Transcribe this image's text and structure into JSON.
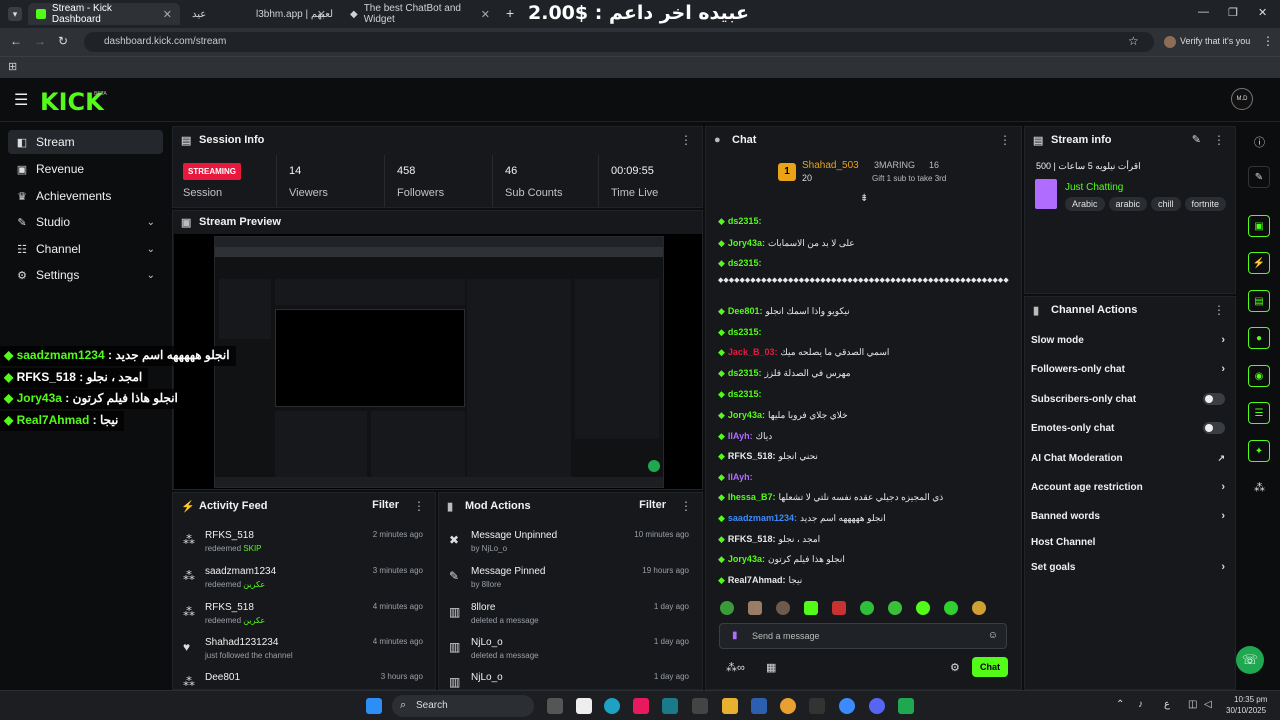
{
  "browser": {
    "tabs": [
      {
        "label": "Stream - Kick Dashboard",
        "active": true
      },
      {
        "label": "عيد",
        "active": false
      },
      {
        "label": "l3bhm.app | لعبهم",
        "active": false
      },
      {
        "label": "The best ChatBot and Widget",
        "active": false
      }
    ],
    "banner": "عبيده اخر داعم : $2.00",
    "url": "dashboard.kick.com/stream",
    "verify": "Verify that it's you"
  },
  "kick": {
    "logo": "KICK",
    "beta": "BETA",
    "avatar": "M.D"
  },
  "sidebar": {
    "items": [
      {
        "label": "Stream"
      },
      {
        "label": "Revenue"
      },
      {
        "label": "Achievements"
      },
      {
        "label": "Studio"
      },
      {
        "label": "Channel"
      },
      {
        "label": "Settings"
      }
    ]
  },
  "session": {
    "title": "Session Info",
    "badge": "STREAMING",
    "session_label": "Session",
    "viewers": "14",
    "viewers_label": "Viewers",
    "followers": "458",
    "followers_label": "Followers",
    "subs": "46",
    "subs_label": "Sub Counts",
    "time": "00:09:55",
    "time_label": "Time Live"
  },
  "preview": {
    "title": "Stream Preview"
  },
  "overlay": [
    {
      "user": "saadzmam1234",
      "text": "انجلو هههههه اسم جديد"
    },
    {
      "user": "RFKS_518",
      "text": "امجد ، نجلو"
    },
    {
      "user": "Jory43a",
      "text": "انجلو هاذا فيلم كرتون"
    },
    {
      "user": "Real7Ahmad",
      "text": "نيجا"
    }
  ],
  "activity": {
    "title": "Activity Feed",
    "filter": "Filter",
    "rows": [
      {
        "name": "RFKS_518",
        "pre": "redeemed",
        "sub": "SKIP",
        "time": "2 minutes ago"
      },
      {
        "name": "saadzmam1234",
        "pre": "redeemed",
        "sub": "عكرين",
        "time": "3 minutes ago"
      },
      {
        "name": "RFKS_518",
        "pre": "redeemed",
        "sub": "عكرين",
        "time": "4 minutes ago"
      },
      {
        "name": "Shahad1231234",
        "pre": "just followed the channel",
        "sub": "",
        "time": "4 minutes ago"
      },
      {
        "name": "Dee801",
        "pre": "",
        "sub": "",
        "time": "3 hours ago"
      }
    ]
  },
  "mod": {
    "title": "Mod Actions",
    "filter": "Filter",
    "rows": [
      {
        "name": "Message Unpinned",
        "sub": "by NjLo_o",
        "time": "10 minutes ago"
      },
      {
        "name": "Message Pinned",
        "sub": "by 8llore",
        "time": "19 hours ago"
      },
      {
        "name": "8llore",
        "sub": "deleted a message",
        "time": "1 day ago"
      },
      {
        "name": "NjLo_o",
        "sub": "deleted a message",
        "time": "1 day ago"
      },
      {
        "name": "NjLo_o",
        "sub": "",
        "time": "1 day ago"
      }
    ]
  },
  "chat": {
    "title": "Chat",
    "gifter_name": "Shahad_503",
    "gifter_count": "20",
    "gift_rank": "3MARING",
    "gift_num": "16",
    "gift_text": "Gift 1 sub to take 3rd",
    "gift_pos": "1",
    "messages": [
      {
        "user": "ds2315:",
        "text": "",
        "color": "#53fc18"
      },
      {
        "user": "Jory43a:",
        "text": "على لا بد من الاسمابات",
        "color": "#53fc18"
      },
      {
        "user": "ds2315:",
        "text": "",
        "color": "#53fc18"
      },
      {
        "user": "",
        "text": "◆◆◆◆◆◆◆◆◆◆◆◆◆◆◆◆◆◆◆◆◆◆◆◆◆◆◆◆◆◆◆◆◆◆◆◆◆◆◆◆◆◆◆◆◆◆◆◆◆◆◆◆◆◆",
        "color": "#e8e8e8"
      },
      {
        "user": "Dee801:",
        "text": "نيكويو واذا اسمك انجلو",
        "color": "#53fc18"
      },
      {
        "user": "ds2315:",
        "text": "",
        "color": "#53fc18"
      },
      {
        "user": "Jack_B_03:",
        "text": "اسمي الصدقي ما يصلحه ميك",
        "color": "#e8193c"
      },
      {
        "user": "ds2315:",
        "text": "مهرس في الصدلة فلزز",
        "color": "#53fc18"
      },
      {
        "user": "ds2315:",
        "text": "",
        "color": "#53fc18"
      },
      {
        "user": "Jory43a:",
        "text": "خلاي جلاي فروبا مليها",
        "color": "#53fc18"
      },
      {
        "user": "IIAyh:",
        "text": "دياك",
        "color": "#b06cff"
      },
      {
        "user": "RFKS_518:",
        "text": "نحني انجلو",
        "color": "#e8e8e8"
      },
      {
        "user": "IIAyh:",
        "text": "",
        "color": "#b06cff"
      },
      {
        "user": "Ihessa_B7:",
        "text": "ذي المجيزه دجيلي عقده نفسه نلتي لا تشعلها",
        "color": "#53fc18"
      },
      {
        "user": "saadzmam1234:",
        "text": "انجلو هههههه اسم جديد",
        "color": "#3a8bff"
      },
      {
        "user": "RFKS_518:",
        "text": "امجد ، نجلو",
        "color": "#e8e8e8"
      },
      {
        "user": "Jory43a:",
        "text": "انجلو هذا فيلم كرتون",
        "color": "#53fc18"
      },
      {
        "user": "Real7Ahmad:",
        "text": "نيجا",
        "color": "#e8e8e8"
      }
    ],
    "placeholder": "Send a message",
    "send": "Chat"
  },
  "streaminfo": {
    "title": "Stream info",
    "stream_title": "500 | اقرأت نيلويه 5 ساعات",
    "category": "Just Chatting",
    "tags": [
      "Arabic",
      "arabic",
      "chill",
      "fortnite"
    ]
  },
  "actions": {
    "title": "Channel Actions",
    "items": [
      {
        "label": "Slow mode",
        "kind": "chevron"
      },
      {
        "label": "Followers-only chat",
        "kind": "chevron"
      },
      {
        "label": "Subscribers-only chat",
        "kind": "toggle"
      },
      {
        "label": "Emotes-only chat",
        "kind": "toggle"
      },
      {
        "label": "AI Chat Moderation",
        "kind": "link"
      },
      {
        "label": "Account age restriction",
        "kind": "chevron"
      },
      {
        "label": "Banned words",
        "kind": "chevron"
      },
      {
        "label": "Host Channel",
        "kind": "none"
      },
      {
        "label": "Set goals",
        "kind": "chevron"
      }
    ]
  },
  "taskbar": {
    "search": "Search",
    "time": "10:35 pm",
    "date": "30/10/2025"
  },
  "colors": {
    "accent": "#53fc18",
    "live": "#e8193c",
    "panel": "#16181c",
    "bg": "#0b0d0f"
  }
}
